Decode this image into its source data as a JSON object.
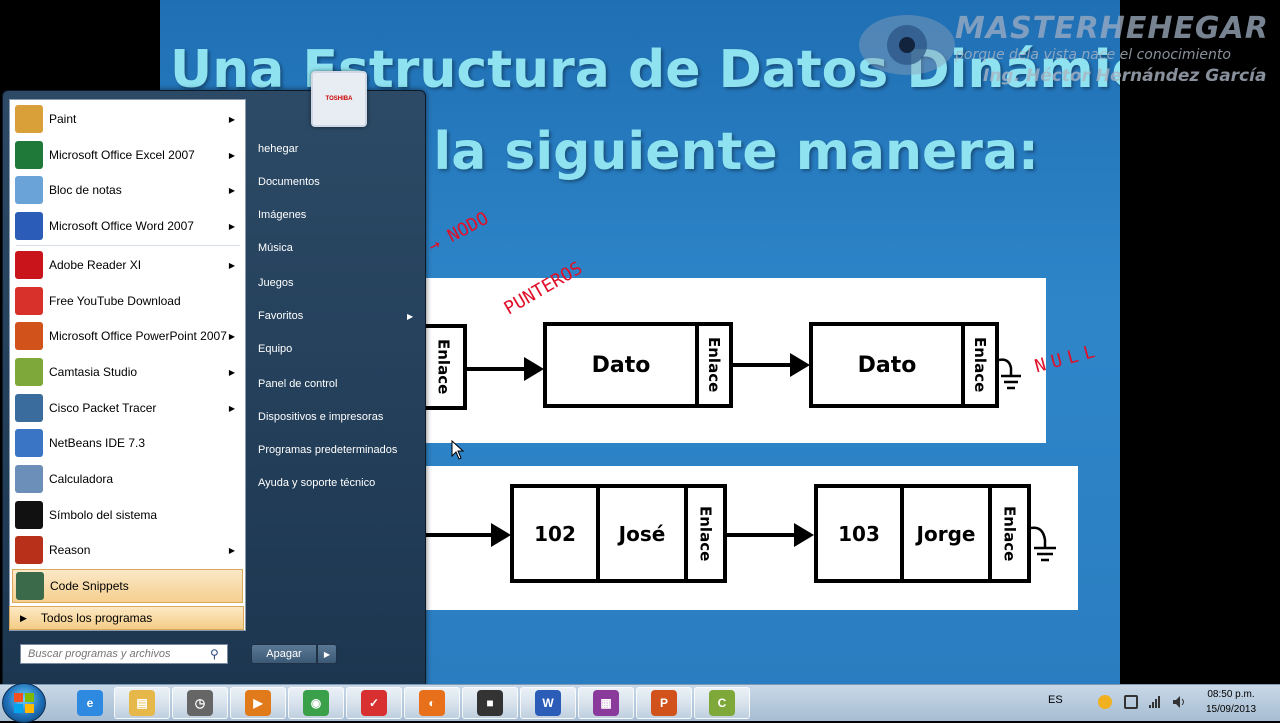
{
  "slide": {
    "title_line1": "Una Estructura de Datos Dinámica",
    "title_line2": "e la siguiente manera:",
    "diagram1": {
      "nodes": [
        {
          "data": "",
          "link": "Enlace"
        },
        {
          "data": "Dato",
          "link": "Enlace"
        },
        {
          "data": "Dato",
          "link": "Enlace"
        }
      ]
    },
    "diagram2": {
      "nodes": [
        {
          "id": "102",
          "name": "José",
          "link": "Enlace"
        },
        {
          "id": "103",
          "name": "Jorge",
          "link": "Enlace"
        }
      ]
    },
    "annotations": {
      "nodo": "→ NODO",
      "punteros": "PUNTEROS",
      "null": "NULL"
    }
  },
  "watermark": {
    "title": "MASTERHEHEGAR",
    "subtitle": "porque dela vista nace el conocimiento",
    "author": "Ing. Héctor Hernández García"
  },
  "start_menu": {
    "programs": [
      {
        "label": "Paint",
        "icon": "paint-icon",
        "color": "#d9a03a",
        "submenu": true
      },
      {
        "label": "Microsoft Office Excel 2007",
        "icon": "excel-icon",
        "color": "#1f7a3a",
        "submenu": true
      },
      {
        "label": "Bloc de notas",
        "icon": "notepad-icon",
        "color": "#6aa3d8",
        "submenu": true
      },
      {
        "label": "Microsoft Office Word 2007",
        "icon": "word-icon",
        "color": "#2b5cb8",
        "submenu": true
      },
      {
        "label": "Adobe Reader XI",
        "icon": "adobe-reader-icon",
        "color": "#c8141a",
        "submenu": true
      },
      {
        "label": "Free YouTube Download",
        "icon": "youtube-download-icon",
        "color": "#d8302a",
        "submenu": false
      },
      {
        "label": "Microsoft Office PowerPoint 2007",
        "icon": "powerpoint-icon",
        "color": "#d2521c",
        "submenu": true
      },
      {
        "label": "Camtasia Studio",
        "icon": "camtasia-icon",
        "color": "#7fa83a",
        "submenu": true
      },
      {
        "label": "Cisco Packet Tracer",
        "icon": "packet-tracer-icon",
        "color": "#3b6c9e",
        "submenu": true
      },
      {
        "label": "NetBeans IDE 7.3",
        "icon": "netbeans-icon",
        "color": "#3a74c4",
        "submenu": false
      },
      {
        "label": "Calculadora",
        "icon": "calculator-icon",
        "color": "#6b8fb8",
        "submenu": false
      },
      {
        "label": "Símbolo del sistema",
        "icon": "cmd-icon",
        "color": "#111111",
        "submenu": false
      },
      {
        "label": "Reason",
        "icon": "reason-icon",
        "color": "#b8301a",
        "submenu": true
      },
      {
        "label": "Code Snippets",
        "icon": "code-snippets-icon",
        "color": "#3a6a4a",
        "submenu": false
      }
    ],
    "all_programs": "Todos los programas",
    "search_placeholder": "Buscar programas y archivos",
    "places": [
      {
        "label": "hehegar",
        "submenu": false
      },
      {
        "label": "Documentos",
        "submenu": false
      },
      {
        "label": "Imágenes",
        "submenu": false
      },
      {
        "label": "Música",
        "submenu": false
      },
      {
        "label": "Juegos",
        "submenu": false
      },
      {
        "label": "Favoritos",
        "submenu": true
      },
      {
        "label": "Equipo",
        "submenu": false
      },
      {
        "label": "Panel de control",
        "submenu": false
      },
      {
        "label": "Dispositivos e impresoras",
        "submenu": false
      },
      {
        "label": "Programas predeterminados",
        "submenu": false
      },
      {
        "label": "Ayuda y soporte técnico",
        "submenu": false
      }
    ],
    "user_picture_text": "TOSHIBA",
    "shutdown": "Apagar"
  },
  "taskbar": {
    "items": [
      {
        "name": "internet-explorer-icon",
        "color": "#2e8ae0",
        "glyph": "e"
      },
      {
        "name": "file-explorer-icon",
        "color": "#e6b84a",
        "glyph": "▤"
      },
      {
        "name": "clock-app-icon",
        "color": "#666666",
        "glyph": "◷"
      },
      {
        "name": "media-player-icon",
        "color": "#e07a1a",
        "glyph": "▶"
      },
      {
        "name": "chrome-icon",
        "color": "#3aa04a",
        "glyph": "◉"
      },
      {
        "name": "todo-app-icon",
        "color": "#d83030",
        "glyph": "✓"
      },
      {
        "name": "firefox-icon",
        "color": "#e8701a",
        "glyph": "◐"
      },
      {
        "name": "camera-icon",
        "color": "#333333",
        "glyph": "■"
      },
      {
        "name": "word-icon",
        "color": "#2b5cb8",
        "glyph": "W"
      },
      {
        "name": "winrar-icon",
        "color": "#8a3a9a",
        "glyph": "▦"
      },
      {
        "name": "powerpoint-icon",
        "color": "#d2521c",
        "glyph": "P"
      },
      {
        "name": "camtasia-icon",
        "color": "#7fa83a",
        "glyph": "C"
      }
    ],
    "language": "ES",
    "time": "08:50 p.m.",
    "date": "15/09/2013"
  }
}
